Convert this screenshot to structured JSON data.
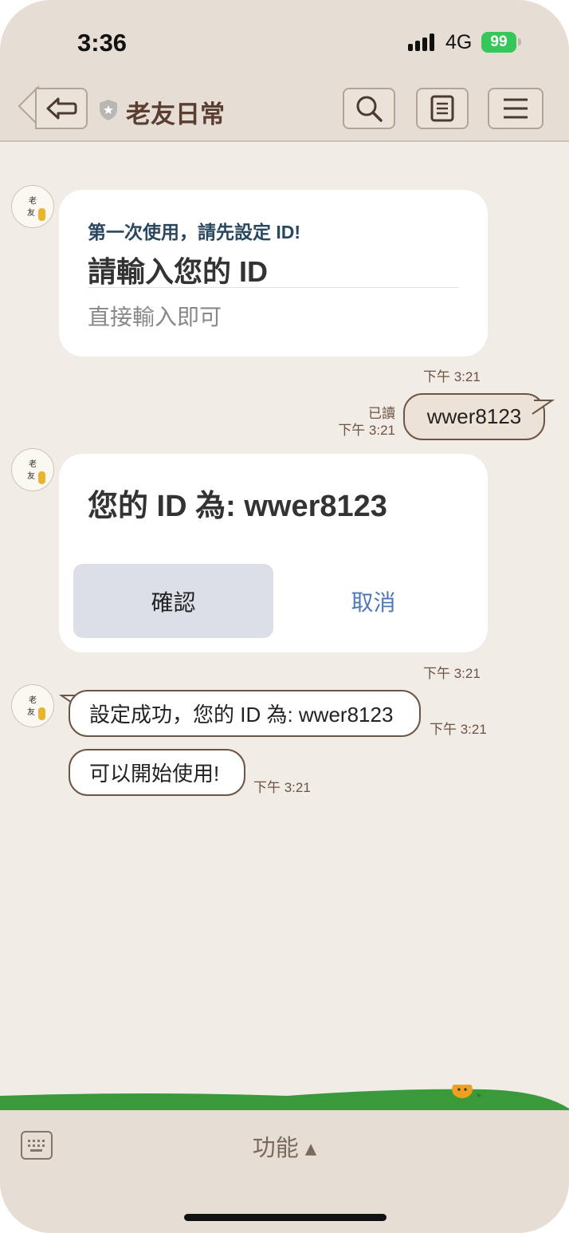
{
  "status_bar": {
    "time": "3:36",
    "network": "4G",
    "battery": "99"
  },
  "header": {
    "title": "老友日常",
    "back_icon": "back-arrow-icon",
    "search_icon": "search-icon",
    "notes_icon": "notes-icon",
    "menu_icon": "menu-icon"
  },
  "messages": {
    "m1": {
      "avatar_text": "老友日常",
      "subtitle": "第一次使用，請先設定 ID!",
      "title": "請輸入您的 ID",
      "hint": "直接輸入即可",
      "time": "下午 3:21"
    },
    "m2": {
      "text": "wwer8123",
      "read": "已讀",
      "time": "下午 3:21"
    },
    "m3": {
      "title": "您的 ID 為: wwer8123",
      "confirm": "確認",
      "cancel": "取消",
      "time": "下午 3:21"
    },
    "m4": {
      "text": "設定成功，您的 ID 為: wwer8123",
      "time": "下午 3:21"
    },
    "m5": {
      "text": "可以開始使用!",
      "time": "下午 3:21"
    }
  },
  "bottom_bar": {
    "function_label": "功能 ▴",
    "keyboard_icon": "keyboard-icon"
  },
  "colors": {
    "background": "#f1ece6",
    "header": "#e6ddd4",
    "accent_brown": "#6d5546",
    "link_blue": "#4e78b3",
    "grass_green": "#3a9a3a"
  }
}
